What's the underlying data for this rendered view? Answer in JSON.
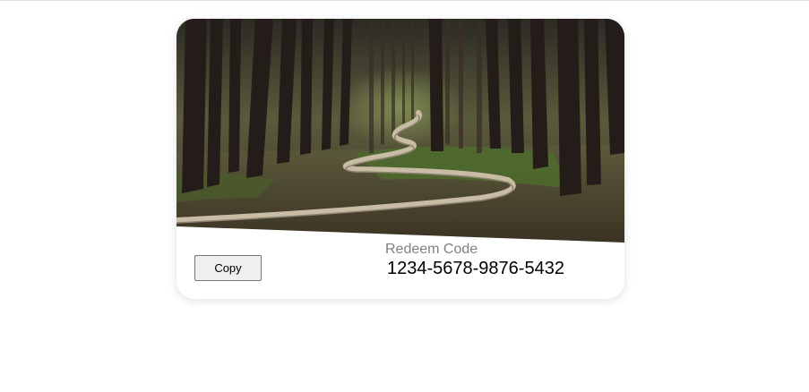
{
  "card": {
    "image_description": "forest-path-photo",
    "copy_button_label": "Copy",
    "code_label": "Redeem Code",
    "code_value": "1234-5678-9876-5432"
  },
  "colors": {
    "label_gray": "#808080",
    "button_bg": "#efefef",
    "button_border": "#767676"
  }
}
